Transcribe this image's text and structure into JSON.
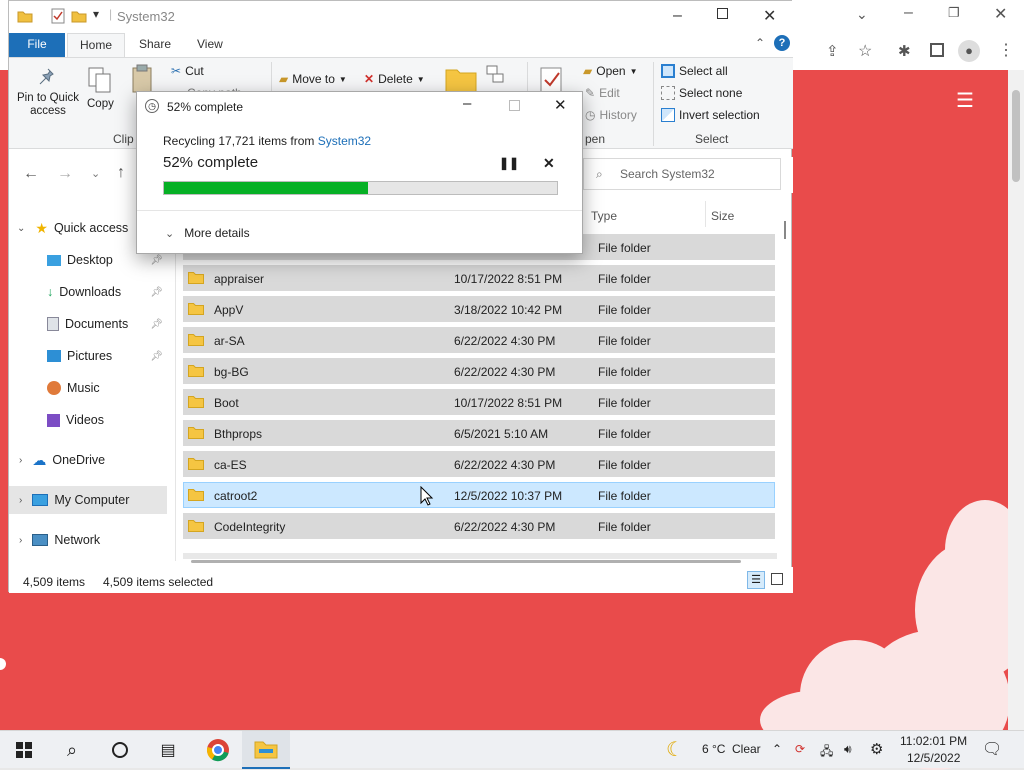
{
  "explorer": {
    "title": "System32",
    "tabs": [
      "File",
      "Home",
      "Share",
      "View"
    ],
    "ribbon": {
      "pin_label": "Pin to Quick access",
      "copy_label": "Copy",
      "paste_partial": "P",
      "cut_label": "Cut",
      "copy_path_partial": "Copy path",
      "clipboard_partial": "Clip",
      "move_to_label": "Move to",
      "delete_label": "Delete",
      "open_label": "Open",
      "edit_label": "Edit",
      "history_label": "History",
      "open_group_partial": "pen",
      "select_all_label": "Select all",
      "select_none_label": "Select none",
      "invert_selection_label": "Invert selection",
      "select_group_label": "Select"
    },
    "search_placeholder": "Search System32",
    "columns": {
      "type": "Type",
      "size": "Size"
    },
    "nav": {
      "quick_access": "Quick access",
      "desktop": "Desktop",
      "downloads": "Downloads",
      "documents": "Documents",
      "pictures": "Pictures",
      "music": "Music",
      "videos": "Videos",
      "onedrive": "OneDrive",
      "my_computer": "My Computer",
      "network": "Network"
    },
    "files": [
      {
        "name": "",
        "date": "",
        "type": "File folder"
      },
      {
        "name": "appraiser",
        "date": "10/17/2022 8:51 PM",
        "type": "File folder"
      },
      {
        "name": "AppV",
        "date": "3/18/2022 10:42 PM",
        "type": "File folder"
      },
      {
        "name": "ar-SA",
        "date": "6/22/2022 4:30 PM",
        "type": "File folder"
      },
      {
        "name": "bg-BG",
        "date": "6/22/2022 4:30 PM",
        "type": "File folder"
      },
      {
        "name": "Boot",
        "date": "10/17/2022 8:51 PM",
        "type": "File folder"
      },
      {
        "name": "Bthprops",
        "date": "6/5/2021 5:10 AM",
        "type": "File folder"
      },
      {
        "name": "ca-ES",
        "date": "6/22/2022 4:30 PM",
        "type": "File folder"
      },
      {
        "name": "catroot2",
        "date": "12/5/2022 10:37 PM",
        "type": "File folder"
      },
      {
        "name": "CodeIntegrity",
        "date": "6/22/2022 4:30 PM",
        "type": "File folder"
      }
    ],
    "status": {
      "items": "4,509 items",
      "selected": "4,509 items selected"
    }
  },
  "dialog": {
    "title": "52% complete",
    "recycling_prefix": "Recycling 17,721 items from",
    "recycling_source": "System32",
    "percent_text": "52% complete",
    "progress": 0.52,
    "more_details": "More details"
  },
  "taskbar": {
    "weather_temp": "6 °C",
    "weather_text": "Clear",
    "time": "11:02:01 PM",
    "date": "12/5/2022"
  },
  "colors": {
    "accent": "#1d6fb8",
    "progress": "#06b025",
    "page_bg": "#e94b4b",
    "selection": "#cce8ff"
  }
}
